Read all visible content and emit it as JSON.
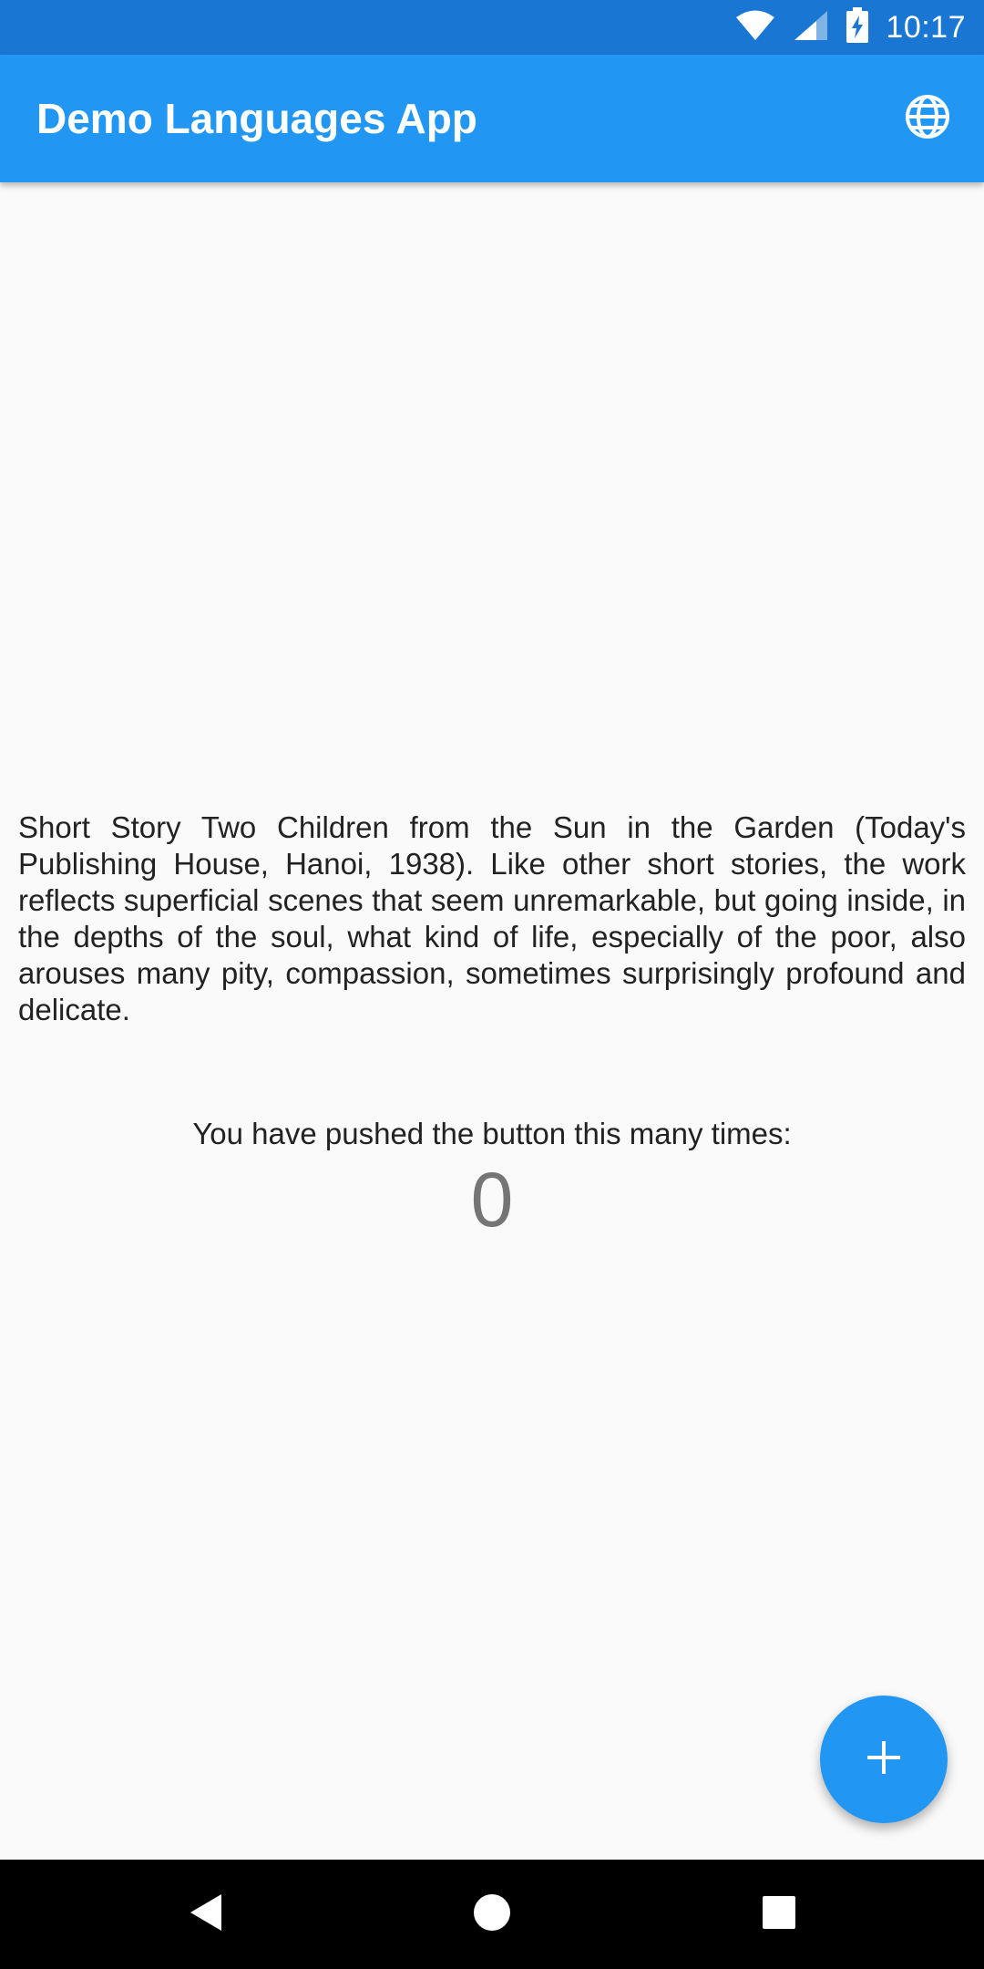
{
  "status_bar": {
    "time": "10:17",
    "icons": [
      "wifi-icon",
      "cell-signal-icon",
      "battery-charging-icon"
    ],
    "color": "#1976d2"
  },
  "app_bar": {
    "title": "Demo Languages App",
    "action_icon": "globe-icon",
    "color": "#2196f3"
  },
  "main": {
    "story": "Short Story Two Children from the Sun in the Garden (Today's Publishing House, Hanoi, 1938). Like other short stories, the work reflects superficial scenes that seem unremarkable, but going inside, in the depths of the soul, what kind of life, especially of the poor, also arouses many pity, compassion, sometimes surprisingly profound and delicate.",
    "counter_label": "You have pushed the button this many times:",
    "counter_value": "0"
  },
  "fab": {
    "icon": "plus-icon",
    "color": "#2196f3"
  },
  "nav_bar": {
    "buttons": [
      "back-icon",
      "home-icon",
      "recents-icon"
    ]
  }
}
